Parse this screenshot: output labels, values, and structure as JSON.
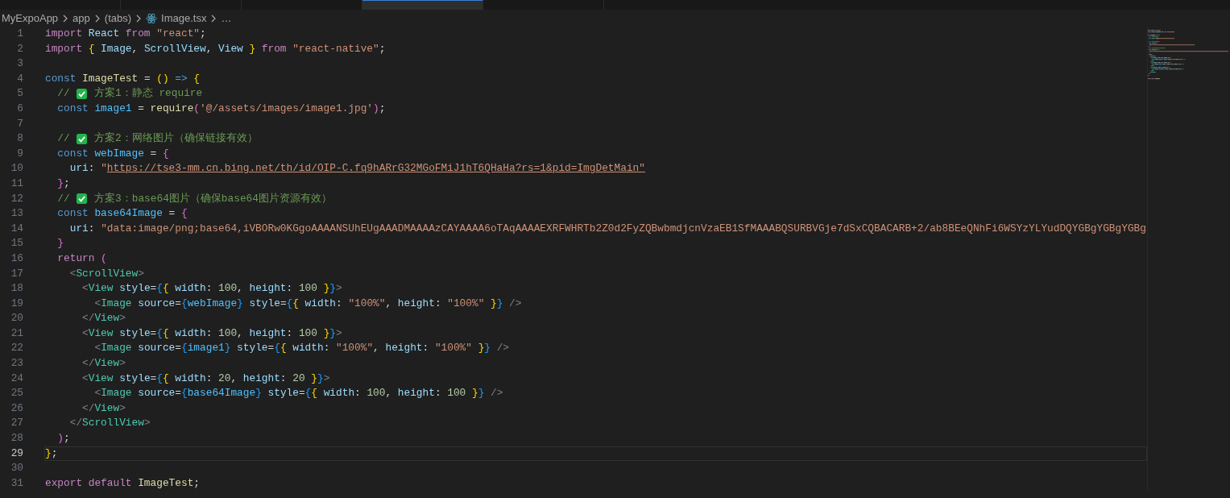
{
  "tabs": [
    {
      "selected": false
    },
    {
      "selected": false
    },
    {
      "selected": false
    },
    {
      "selected": true
    },
    {
      "selected": false
    }
  ],
  "breadcrumb": [
    {
      "kind": "folder",
      "text": "MyExpoApp"
    },
    {
      "kind": "folder",
      "text": "app"
    },
    {
      "kind": "folder",
      "text": "(tabs)"
    },
    {
      "kind": "file",
      "text": "Image.tsx"
    },
    {
      "kind": "more",
      "text": "…"
    }
  ],
  "lines": [
    {
      "number": "1",
      "current": false,
      "tokens": [
        {
          "kind": "kw",
          "text": "import"
        },
        {
          "kind": "var",
          "text": " React"
        },
        {
          "kind": "kw",
          "text": " from"
        },
        {
          "kind": "str",
          "text": " \"react\""
        },
        {
          "kind": "p",
          "text": ";"
        }
      ]
    },
    {
      "number": "2",
      "current": false,
      "tokens": [
        {
          "kind": "kw",
          "text": "import"
        },
        {
          "kind": "b1",
          "text": " {"
        },
        {
          "kind": "var",
          "text": " Image"
        },
        {
          "kind": "p",
          "text": ", "
        },
        {
          "kind": "var",
          "text": "ScrollView"
        },
        {
          "kind": "p",
          "text": ", "
        },
        {
          "kind": "var",
          "text": "View"
        },
        {
          "kind": "b1",
          "text": " }"
        },
        {
          "kind": "kw",
          "text": " from"
        },
        {
          "kind": "str",
          "text": " \"react-native\""
        },
        {
          "kind": "p",
          "text": ";"
        }
      ]
    },
    {
      "number": "3",
      "current": false
    },
    {
      "number": "4",
      "current": false,
      "tokens": [
        {
          "kind": "st",
          "text": "const"
        },
        {
          "kind": "fn",
          "text": " ImageTest"
        },
        {
          "kind": "p",
          "text": " = "
        },
        {
          "kind": "b1",
          "text": "()"
        },
        {
          "kind": "st",
          "text": " =>"
        },
        {
          "kind": "b1",
          "text": " {"
        }
      ]
    },
    {
      "number": "5",
      "current": false,
      "tokens": [
        {
          "kind": "cm",
          "text": "  // "
        },
        {
          "kind": "emoji"
        },
        {
          "kind": "cm",
          "text": " 方案1：静态 require"
        }
      ]
    },
    {
      "number": "6",
      "current": false,
      "tokens": [
        {
          "kind": "st",
          "text": "  const"
        },
        {
          "kind": "cn",
          "text": " image1"
        },
        {
          "kind": "p",
          "text": " = "
        },
        {
          "kind": "fn",
          "text": "require"
        },
        {
          "kind": "b2",
          "text": "("
        },
        {
          "kind": "str",
          "text": "'@/assets/images/image1.jpg'"
        },
        {
          "kind": "b2",
          "text": ")"
        },
        {
          "kind": "p",
          "text": ";"
        }
      ]
    },
    {
      "number": "7",
      "current": false
    },
    {
      "number": "8",
      "current": false,
      "tokens": [
        {
          "kind": "cm",
          "text": "  // "
        },
        {
          "kind": "emoji"
        },
        {
          "kind": "cm",
          "text": " 方案2：网络图片（确保链接有效）"
        }
      ]
    },
    {
      "number": "9",
      "current": false,
      "tokens": [
        {
          "kind": "st",
          "text": "  const"
        },
        {
          "kind": "cn",
          "text": " webImage"
        },
        {
          "kind": "p",
          "text": " = "
        },
        {
          "kind": "b2",
          "text": "{"
        }
      ]
    },
    {
      "number": "10",
      "current": false,
      "tokens": [
        {
          "kind": "var",
          "text": "    uri"
        },
        {
          "kind": "p",
          "text": ": "
        },
        {
          "kind": "str",
          "text": "\""
        },
        {
          "kind": "link",
          "text": "https://tse3-mm.cn.bing.net/th/id/OIP-C.fq9hARrG32MGoFMiJ1hT6QHaHa?rs=1&pid=ImgDetMain\""
        }
      ]
    },
    {
      "number": "11",
      "current": false,
      "tokens": [
        {
          "kind": "b2",
          "text": "  }"
        },
        {
          "kind": "p",
          "text": ";"
        }
      ]
    },
    {
      "number": "12",
      "current": false,
      "tokens": [
        {
          "kind": "cm",
          "text": "  // "
        },
        {
          "kind": "emoji"
        },
        {
          "kind": "cm",
          "text": " 方案3：base64图片（确保base64图片资源有效）"
        }
      ]
    },
    {
      "number": "13",
      "current": false,
      "tokens": [
        {
          "kind": "st",
          "text": "  const"
        },
        {
          "kind": "cn",
          "text": " base64Image"
        },
        {
          "kind": "p",
          "text": " = "
        },
        {
          "kind": "b2",
          "text": "{"
        }
      ]
    },
    {
      "number": "14",
      "current": false,
      "tokens": [
        {
          "kind": "var",
          "text": "    uri"
        },
        {
          "kind": "p",
          "text": ": "
        },
        {
          "kind": "str",
          "text": "\"data:image/png;base64,iVBORw0KGgoAAAANSUhEUgAAADMAAAAzCAYAAAA6oTAqAAAAEXRFWHRTb2Z0d2FyZQBwbmdjcnVzaEB1SfMAAABQSURBVGje7dSxCQBACARB+2/ab8BEeQNhFi6WSYzYLYudDQYGBgYGBgYGBg"
        }
      ]
    },
    {
      "number": "15",
      "current": false,
      "tokens": [
        {
          "kind": "b2",
          "text": "  }"
        }
      ]
    },
    {
      "number": "16",
      "current": false,
      "tokens": [
        {
          "kind": "kw",
          "text": "  return"
        },
        {
          "kind": "b2",
          "text": " ("
        }
      ]
    },
    {
      "number": "17",
      "current": false,
      "tokens": [
        {
          "kind": "tagp",
          "text": "    <"
        },
        {
          "kind": "tag",
          "text": "ScrollView"
        },
        {
          "kind": "tagp",
          "text": ">"
        }
      ]
    },
    {
      "number": "18",
      "current": false,
      "tokens": [
        {
          "kind": "tagp",
          "text": "      <"
        },
        {
          "kind": "tag",
          "text": "View"
        },
        {
          "kind": "var",
          "text": " style"
        },
        {
          "kind": "p",
          "text": "="
        },
        {
          "kind": "b3",
          "text": "{"
        },
        {
          "kind": "b1",
          "text": "{"
        },
        {
          "kind": "var",
          "text": " width"
        },
        {
          "kind": "p",
          "text": ": "
        },
        {
          "kind": "num",
          "text": "100"
        },
        {
          "kind": "p",
          "text": ", "
        },
        {
          "kind": "var",
          "text": "height"
        },
        {
          "kind": "p",
          "text": ": "
        },
        {
          "kind": "num",
          "text": "100"
        },
        {
          "kind": "b1",
          "text": " }"
        },
        {
          "kind": "b3",
          "text": "}"
        },
        {
          "kind": "tagp",
          "text": ">"
        }
      ]
    },
    {
      "number": "19",
      "current": false,
      "tokens": [
        {
          "kind": "tagp",
          "text": "        <"
        },
        {
          "kind": "tag",
          "text": "Image"
        },
        {
          "kind": "var",
          "text": " source"
        },
        {
          "kind": "p",
          "text": "="
        },
        {
          "kind": "b3",
          "text": "{"
        },
        {
          "kind": "cn",
          "text": "webImage"
        },
        {
          "kind": "b3",
          "text": "}"
        },
        {
          "kind": "var",
          "text": " style"
        },
        {
          "kind": "p",
          "text": "="
        },
        {
          "kind": "b3",
          "text": "{"
        },
        {
          "kind": "b1",
          "text": "{"
        },
        {
          "kind": "var",
          "text": " width"
        },
        {
          "kind": "p",
          "text": ": "
        },
        {
          "kind": "str",
          "text": "\"100%\""
        },
        {
          "kind": "p",
          "text": ", "
        },
        {
          "kind": "var",
          "text": "height"
        },
        {
          "kind": "p",
          "text": ": "
        },
        {
          "kind": "str",
          "text": "\"100%\""
        },
        {
          "kind": "b1",
          "text": " }"
        },
        {
          "kind": "b3",
          "text": "}"
        },
        {
          "kind": "tagp",
          "text": " />"
        }
      ]
    },
    {
      "number": "20",
      "current": false,
      "tokens": [
        {
          "kind": "tagp",
          "text": "      </"
        },
        {
          "kind": "tag",
          "text": "View"
        },
        {
          "kind": "tagp",
          "text": ">"
        }
      ]
    },
    {
      "number": "21",
      "current": false,
      "tokens": [
        {
          "kind": "tagp",
          "text": "      <"
        },
        {
          "kind": "tag",
          "text": "View"
        },
        {
          "kind": "var",
          "text": " style"
        },
        {
          "kind": "p",
          "text": "="
        },
        {
          "kind": "b3",
          "text": "{"
        },
        {
          "kind": "b1",
          "text": "{"
        },
        {
          "kind": "var",
          "text": " width"
        },
        {
          "kind": "p",
          "text": ": "
        },
        {
          "kind": "num",
          "text": "100"
        },
        {
          "kind": "p",
          "text": ", "
        },
        {
          "kind": "var",
          "text": "height"
        },
        {
          "kind": "p",
          "text": ": "
        },
        {
          "kind": "num",
          "text": "100"
        },
        {
          "kind": "b1",
          "text": " }"
        },
        {
          "kind": "b3",
          "text": "}"
        },
        {
          "kind": "tagp",
          "text": ">"
        }
      ]
    },
    {
      "number": "22",
      "current": false,
      "tokens": [
        {
          "kind": "tagp",
          "text": "        <"
        },
        {
          "kind": "tag",
          "text": "Image"
        },
        {
          "kind": "var",
          "text": " source"
        },
        {
          "kind": "p",
          "text": "="
        },
        {
          "kind": "b3",
          "text": "{"
        },
        {
          "kind": "cn",
          "text": "image1"
        },
        {
          "kind": "b3",
          "text": "}"
        },
        {
          "kind": "var",
          "text": " style"
        },
        {
          "kind": "p",
          "text": "="
        },
        {
          "kind": "b3",
          "text": "{"
        },
        {
          "kind": "b1",
          "text": "{"
        },
        {
          "kind": "var",
          "text": " width"
        },
        {
          "kind": "p",
          "text": ": "
        },
        {
          "kind": "str",
          "text": "\"100%\""
        },
        {
          "kind": "p",
          "text": ", "
        },
        {
          "kind": "var",
          "text": "height"
        },
        {
          "kind": "p",
          "text": ": "
        },
        {
          "kind": "str",
          "text": "\"100%\""
        },
        {
          "kind": "b1",
          "text": " }"
        },
        {
          "kind": "b3",
          "text": "}"
        },
        {
          "kind": "tagp",
          "text": " />"
        }
      ]
    },
    {
      "number": "23",
      "current": false,
      "tokens": [
        {
          "kind": "tagp",
          "text": "      </"
        },
        {
          "kind": "tag",
          "text": "View"
        },
        {
          "kind": "tagp",
          "text": ">"
        }
      ]
    },
    {
      "number": "24",
      "current": false,
      "tokens": [
        {
          "kind": "tagp",
          "text": "      <"
        },
        {
          "kind": "tag",
          "text": "View"
        },
        {
          "kind": "var",
          "text": " style"
        },
        {
          "kind": "p",
          "text": "="
        },
        {
          "kind": "b3",
          "text": "{"
        },
        {
          "kind": "b1",
          "text": "{"
        },
        {
          "kind": "var",
          "text": " width"
        },
        {
          "kind": "p",
          "text": ": "
        },
        {
          "kind": "num",
          "text": "20"
        },
        {
          "kind": "p",
          "text": ", "
        },
        {
          "kind": "var",
          "text": "height"
        },
        {
          "kind": "p",
          "text": ": "
        },
        {
          "kind": "num",
          "text": "20"
        },
        {
          "kind": "b1",
          "text": " }"
        },
        {
          "kind": "b3",
          "text": "}"
        },
        {
          "kind": "tagp",
          "text": ">"
        }
      ]
    },
    {
      "number": "25",
      "current": false,
      "tokens": [
        {
          "kind": "tagp",
          "text": "        <"
        },
        {
          "kind": "tag",
          "text": "Image"
        },
        {
          "kind": "var",
          "text": " source"
        },
        {
          "kind": "p",
          "text": "="
        },
        {
          "kind": "b3",
          "text": "{"
        },
        {
          "kind": "cn",
          "text": "base64Image"
        },
        {
          "kind": "b3",
          "text": "}"
        },
        {
          "kind": "var",
          "text": " style"
        },
        {
          "kind": "p",
          "text": "="
        },
        {
          "kind": "b3",
          "text": "{"
        },
        {
          "kind": "b1",
          "text": "{"
        },
        {
          "kind": "var",
          "text": " width"
        },
        {
          "kind": "p",
          "text": ": "
        },
        {
          "kind": "num",
          "text": "100"
        },
        {
          "kind": "p",
          "text": ", "
        },
        {
          "kind": "var",
          "text": "height"
        },
        {
          "kind": "p",
          "text": ": "
        },
        {
          "kind": "num",
          "text": "100"
        },
        {
          "kind": "b1",
          "text": " }"
        },
        {
          "kind": "b3",
          "text": "}"
        },
        {
          "kind": "tagp",
          "text": " />"
        }
      ]
    },
    {
      "number": "26",
      "current": false,
      "tokens": [
        {
          "kind": "tagp",
          "text": "      </"
        },
        {
          "kind": "tag",
          "text": "View"
        },
        {
          "kind": "tagp",
          "text": ">"
        }
      ]
    },
    {
      "number": "27",
      "current": false,
      "tokens": [
        {
          "kind": "tagp",
          "text": "    </"
        },
        {
          "kind": "tag",
          "text": "ScrollView"
        },
        {
          "kind": "tagp",
          "text": ">"
        }
      ]
    },
    {
      "number": "28",
      "current": false,
      "tokens": [
        {
          "kind": "b2",
          "text": "  )"
        },
        {
          "kind": "p",
          "text": ";"
        }
      ]
    },
    {
      "number": "29",
      "current": true,
      "tokens": [
        {
          "kind": "b1",
          "text": "}"
        },
        {
          "kind": "p",
          "text": ";"
        }
      ]
    },
    {
      "number": "30",
      "current": false
    },
    {
      "number": "31",
      "current": false,
      "tokens": [
        {
          "kind": "kw",
          "text": "export"
        },
        {
          "kind": "kw",
          "text": " default"
        },
        {
          "kind": "fn",
          "text": " ImageTest"
        },
        {
          "kind": "p",
          "text": ";"
        }
      ]
    }
  ]
}
